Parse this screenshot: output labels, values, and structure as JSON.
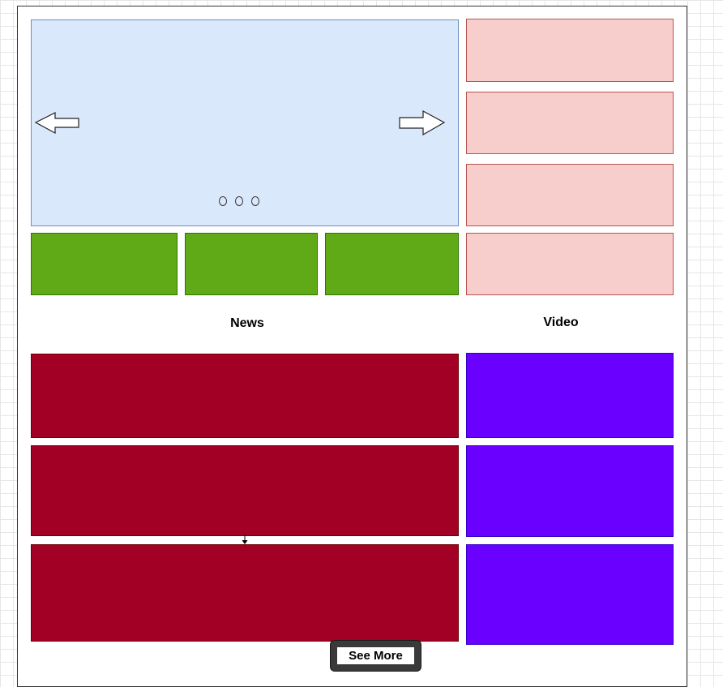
{
  "labels": {
    "news": "News",
    "video": "Video"
  },
  "buttons": {
    "see_more": "See More"
  },
  "slider": {
    "indicator_count": 3,
    "prev_icon": "left-arrow-icon",
    "next_icon": "right-arrow-icon"
  },
  "colors": {
    "slider_fill": "#dae8fc",
    "slider_stroke": "#6c8ebf",
    "side_fill": "#f8cecc",
    "side_stroke": "#b85450",
    "green_fill": "#60a917",
    "news_fill": "#a20025",
    "video_fill": "#6a00ff"
  }
}
